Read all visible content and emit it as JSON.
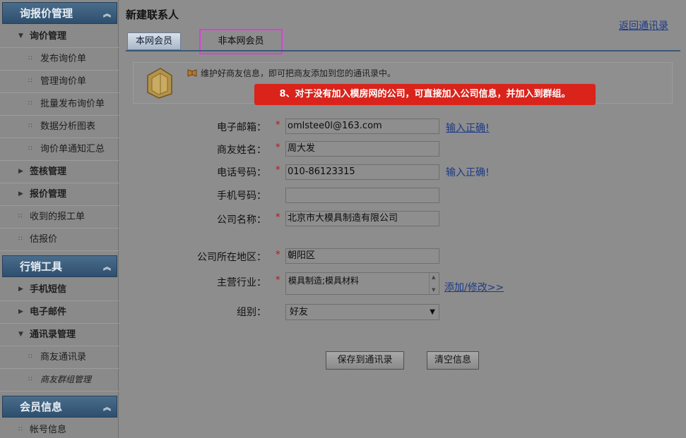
{
  "sidebar": {
    "sections": [
      {
        "title": "询报价管理"
      },
      {
        "title": "行销工具"
      },
      {
        "title": "会员信息"
      }
    ],
    "items": [
      {
        "label": "询价管理"
      },
      {
        "label": "发布询价单"
      },
      {
        "label": "管理询价单"
      },
      {
        "label": "批量发布询价单"
      },
      {
        "label": "数据分析图表"
      },
      {
        "label": "询价单通知汇总"
      },
      {
        "label": "签核管理"
      },
      {
        "label": "报价管理"
      },
      {
        "label": "收到的报工单"
      },
      {
        "label": "估报价"
      },
      {
        "label": "手机短信"
      },
      {
        "label": "电子邮件"
      },
      {
        "label": "通讯录管理"
      },
      {
        "label": "商友通讯录"
      },
      {
        "label": "商友群组管理"
      },
      {
        "label": "帐号信息"
      }
    ]
  },
  "main": {
    "title": "新建联系人",
    "back_link": "返回通讯录",
    "tabs": [
      {
        "label": "本网会员"
      },
      {
        "label": "非本网会员"
      }
    ],
    "info_text": "维护好商友信息，即可把商友添加到您的通讯录中。",
    "callout": "8、对于没有加入模房网的公司，可直接加入公司信息，并加入到群组。",
    "form": {
      "email": {
        "label": "电子邮箱：",
        "value": "omlstee0l@163.com",
        "hint": "输入正确!"
      },
      "name": {
        "label": "商友姓名：",
        "value": "周大发"
      },
      "phone": {
        "label": "电话号码：",
        "value": "010-86123315",
        "hint": "输入正确!"
      },
      "mobile": {
        "label": "手机号码：",
        "value": ""
      },
      "company": {
        "label": "公司名称：",
        "value": "北京市大模具制造有限公司"
      },
      "region": {
        "label": "公司所在地区：",
        "value": "朝阳区"
      },
      "industry": {
        "label": "主营行业：",
        "value": "模具制造;模具材料",
        "link": "添加/修改>>"
      },
      "group": {
        "label": "组别：",
        "value": "好友"
      },
      "required_mark": "*"
    },
    "buttons": {
      "save": "保存到通讯录",
      "clear": "清空信息"
    }
  },
  "colors": {
    "callout": "#d9231b",
    "tab_highlight": "#e239e2",
    "link": "#1c3a86",
    "header": "#2e4f6d"
  }
}
